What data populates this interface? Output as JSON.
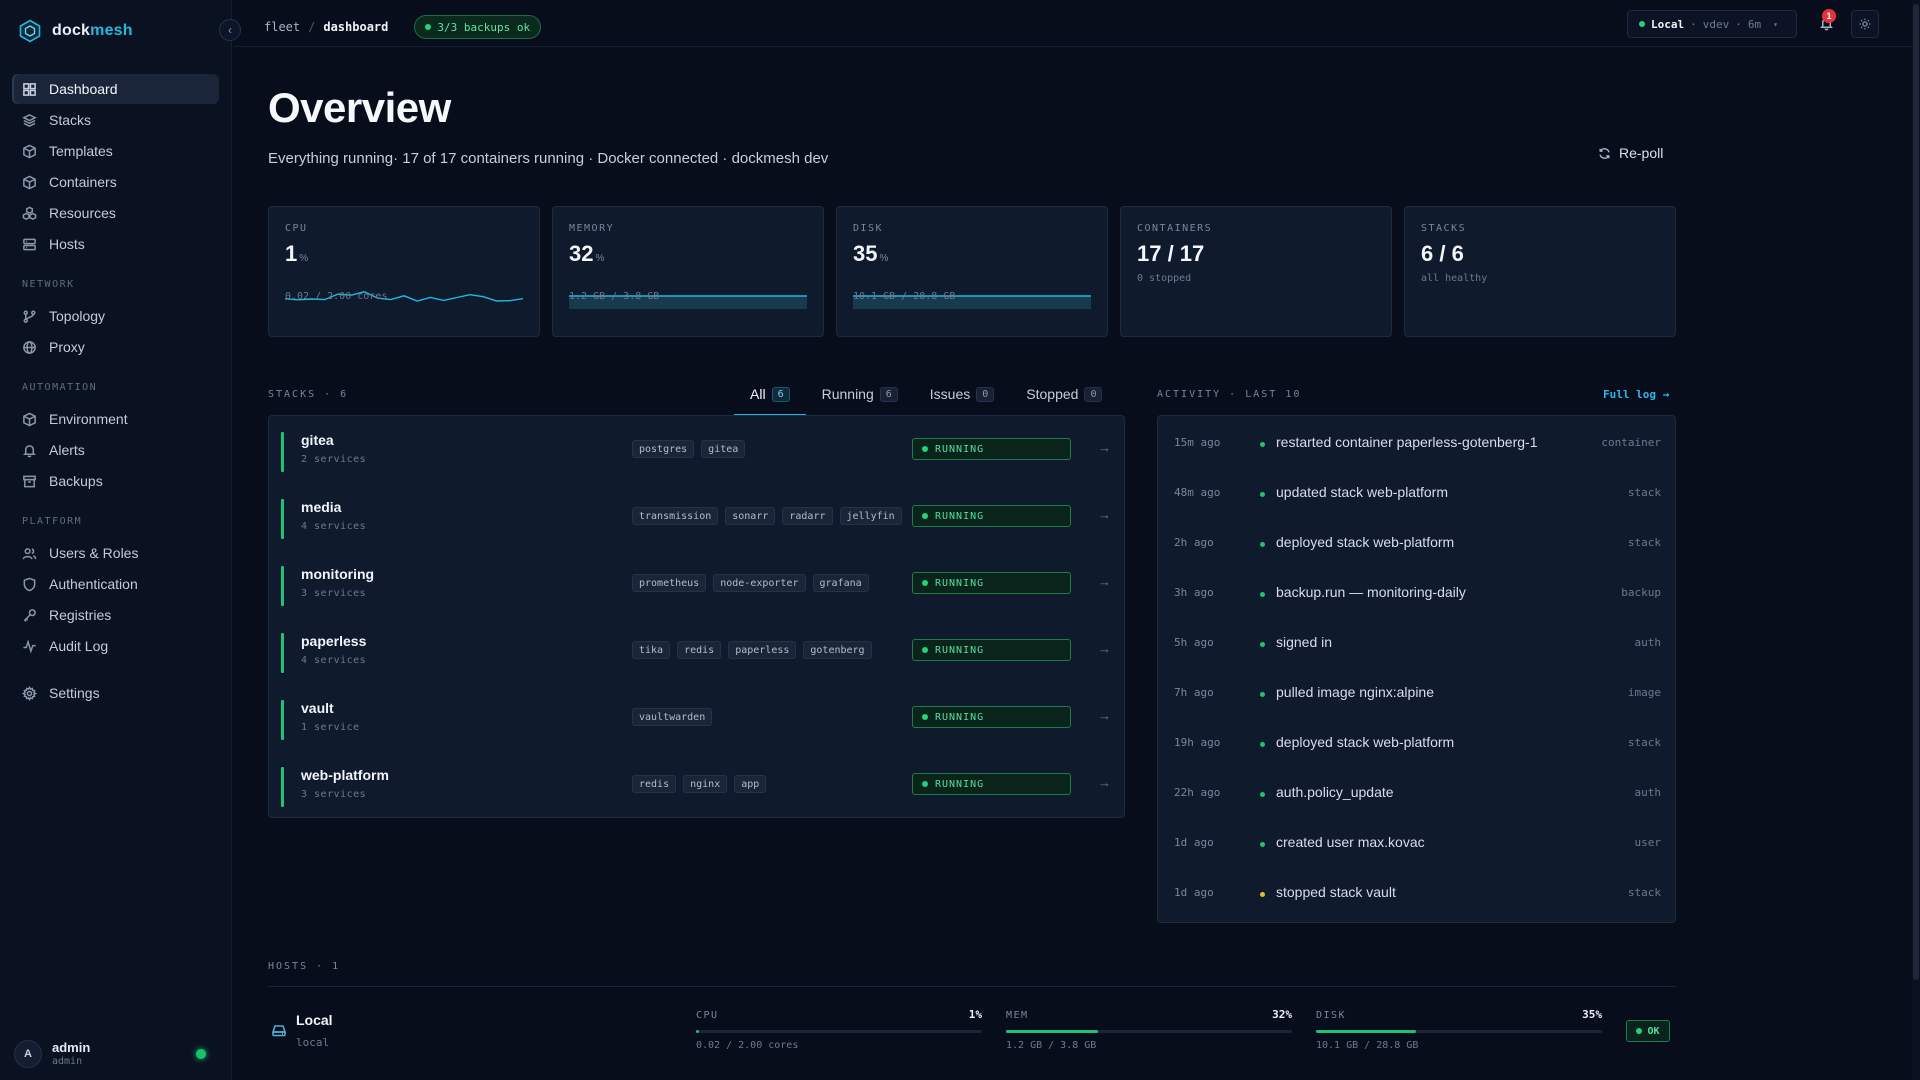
{
  "brand": {
    "prefix": "dock",
    "suffix": "mesh"
  },
  "sidebar": {
    "main": [
      {
        "label": "Dashboard",
        "icon": "grid-icon",
        "active": true
      },
      {
        "label": "Stacks",
        "icon": "layers-icon"
      },
      {
        "label": "Templates",
        "icon": "box-icon"
      },
      {
        "label": "Containers",
        "icon": "cube-icon"
      },
      {
        "label": "Resources",
        "icon": "boxes-icon"
      },
      {
        "label": "Hosts",
        "icon": "server-icon"
      }
    ],
    "network_title": "NETWORK",
    "network": [
      {
        "label": "Topology",
        "icon": "branch-icon"
      },
      {
        "label": "Proxy",
        "icon": "globe-icon"
      }
    ],
    "automation_title": "AUTOMATION",
    "automation": [
      {
        "label": "Environment",
        "icon": "cube-icon"
      },
      {
        "label": "Alerts",
        "icon": "bell-icon"
      },
      {
        "label": "Backups",
        "icon": "archive-icon"
      }
    ],
    "platform_title": "PLATFORM",
    "platform": [
      {
        "label": "Users & Roles",
        "icon": "users-icon"
      },
      {
        "label": "Authentication",
        "icon": "shield-icon"
      },
      {
        "label": "Registries",
        "icon": "key-icon"
      },
      {
        "label": "Audit Log",
        "icon": "activity-icon"
      }
    ],
    "settings": {
      "label": "Settings",
      "icon": "gear-icon"
    },
    "user": {
      "initial": "A",
      "name": "admin",
      "role": "admin"
    }
  },
  "topbar": {
    "crumb_root": "fleet",
    "crumb_sep": "/",
    "crumb_current": "dashboard",
    "backup_badge": "3/3 backups ok",
    "host_label": "Local",
    "host_sep": "·",
    "host_version": "vdev",
    "host_uptime": "6m",
    "notifications": "1"
  },
  "page": {
    "title": "Overview",
    "subtitle": "Everything running· 17 of 17 containers running · Docker connected · dockmesh dev",
    "repoll": "Re-poll"
  },
  "stats": [
    {
      "label": "CPU",
      "value": "1",
      "unit": "%",
      "sub": "0.02 / 2.00 cores",
      "trend": [
        0.08,
        0.04,
        0.07,
        0.05,
        0.24,
        0.2,
        0.32,
        0.1,
        0.05,
        0.18,
        0.0,
        0.12,
        0.02,
        0.12,
        0.22,
        0.15,
        0.0,
        0.01,
        0.08
      ]
    },
    {
      "label": "MEMORY",
      "value": "32",
      "unit": "%",
      "sub": "1.2 GB / 3.8 GB",
      "trend": [
        0.32,
        0.32,
        0.32,
        0.32,
        0.32,
        0.32,
        0.32,
        0.32,
        0.32,
        0.32
      ]
    },
    {
      "label": "DISK",
      "value": "35",
      "unit": "%",
      "sub": "10.1 GB / 28.8 GB",
      "trend": [
        0.35,
        0.35,
        0.35,
        0.35,
        0.35,
        0.35,
        0.35,
        0.35,
        0.35,
        0.35
      ]
    },
    {
      "label": "CONTAINERS",
      "value": "17 / 17",
      "unit": "",
      "sub": "0 stopped"
    },
    {
      "label": "STACKS",
      "value": "6 / 6",
      "unit": "",
      "sub": "all healthy"
    }
  ],
  "stacks_section": {
    "label": "STACKS · 6",
    "tabs": [
      {
        "label": "All",
        "count": "6",
        "active": true
      },
      {
        "label": "Running",
        "count": "6"
      },
      {
        "label": "Issues",
        "count": "0"
      },
      {
        "label": "Stopped",
        "count": "0"
      }
    ],
    "rows": [
      {
        "name": "gitea",
        "services": "2 services",
        "images": [
          "postgres",
          "gitea"
        ],
        "status": "RUNNING"
      },
      {
        "name": "media",
        "services": "4 services",
        "images": [
          "transmission",
          "sonarr",
          "radarr",
          "jellyfin"
        ],
        "status": "RUNNING"
      },
      {
        "name": "monitoring",
        "services": "3 services",
        "images": [
          "prometheus",
          "node-exporter",
          "grafana"
        ],
        "status": "RUNNING"
      },
      {
        "name": "paperless",
        "services": "4 services",
        "images": [
          "tika",
          "redis",
          "paperless",
          "gotenberg"
        ],
        "status": "RUNNING"
      },
      {
        "name": "vault",
        "services": "1 service",
        "images": [
          "vaultwarden"
        ],
        "status": "RUNNING"
      },
      {
        "name": "web-platform",
        "services": "3 services",
        "images": [
          "redis",
          "nginx",
          "app"
        ],
        "status": "RUNNING"
      }
    ]
  },
  "activity": {
    "label": "ACTIVITY · LAST 10",
    "full_log": "Full log →",
    "rows": [
      {
        "time": "15m ago",
        "text": "restarted container paperless-gotenberg-1",
        "type": "container",
        "level": "ok"
      },
      {
        "time": "48m ago",
        "text": "updated stack web-platform",
        "type": "stack",
        "level": "ok"
      },
      {
        "time": "2h ago",
        "text": "deployed stack web-platform",
        "type": "stack",
        "level": "ok"
      },
      {
        "time": "3h ago",
        "text": "backup.run — monitoring-daily",
        "type": "backup",
        "level": "ok"
      },
      {
        "time": "5h ago",
        "text": "signed in",
        "type": "auth",
        "level": "ok"
      },
      {
        "time": "7h ago",
        "text": "pulled image nginx:alpine",
        "type": "image",
        "level": "ok"
      },
      {
        "time": "19h ago",
        "text": "deployed stack web-platform",
        "type": "stack",
        "level": "ok"
      },
      {
        "time": "22h ago",
        "text": "auth.policy_update",
        "type": "auth",
        "level": "ok"
      },
      {
        "time": "1d ago",
        "text": "created user max.kovac",
        "type": "user",
        "level": "ok"
      },
      {
        "time": "1d ago",
        "text": "stopped stack vault",
        "type": "stack",
        "level": "warn"
      }
    ]
  },
  "hosts": {
    "label": "HOSTS · 1",
    "items": [
      {
        "name": "Local",
        "sub": "local",
        "status": "OK",
        "meters": [
          {
            "label": "CPU",
            "pct": "1%",
            "fraction": 0.01,
            "sub": "0.02 / 2.00 cores"
          },
          {
            "label": "MEM",
            "pct": "32%",
            "fraction": 0.32,
            "sub": "1.2 GB / 3.8 GB"
          },
          {
            "label": "DISK",
            "pct": "35%",
            "fraction": 0.35,
            "sub": "10.1 GB / 28.8 GB"
          }
        ]
      }
    ]
  },
  "colors": {
    "accent": "#22b8e0",
    "ok": "#1ec274",
    "warn": "#f1b433",
    "danger": "#e5323c",
    "background": "#070d1b"
  }
}
